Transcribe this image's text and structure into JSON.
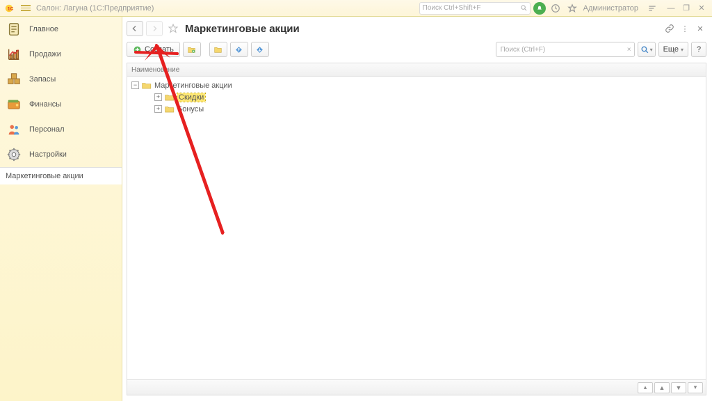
{
  "app": {
    "title": "Салон: Лагуна  (1С:Предприятие)",
    "user": "Администратор"
  },
  "global_search": {
    "placeholder": "Поиск Ctrl+Shift+F"
  },
  "sidebar": {
    "items": [
      {
        "label": "Главное"
      },
      {
        "label": "Продажи"
      },
      {
        "label": "Запасы"
      },
      {
        "label": "Финансы"
      },
      {
        "label": "Персонал"
      },
      {
        "label": "Настройки"
      }
    ],
    "subnav": "Маркетинговые акции"
  },
  "page": {
    "title": "Маркетинговые акции"
  },
  "toolbar": {
    "create": "Создать",
    "search_placeholder": "Поиск (Ctrl+F)",
    "more": "Еще",
    "help": "?"
  },
  "grid": {
    "header": "Наименование"
  },
  "tree": {
    "root": "Маркетинговые акции",
    "children": [
      {
        "label": "Скидки",
        "selected": true
      },
      {
        "label": "Бонусы",
        "selected": false
      }
    ]
  }
}
